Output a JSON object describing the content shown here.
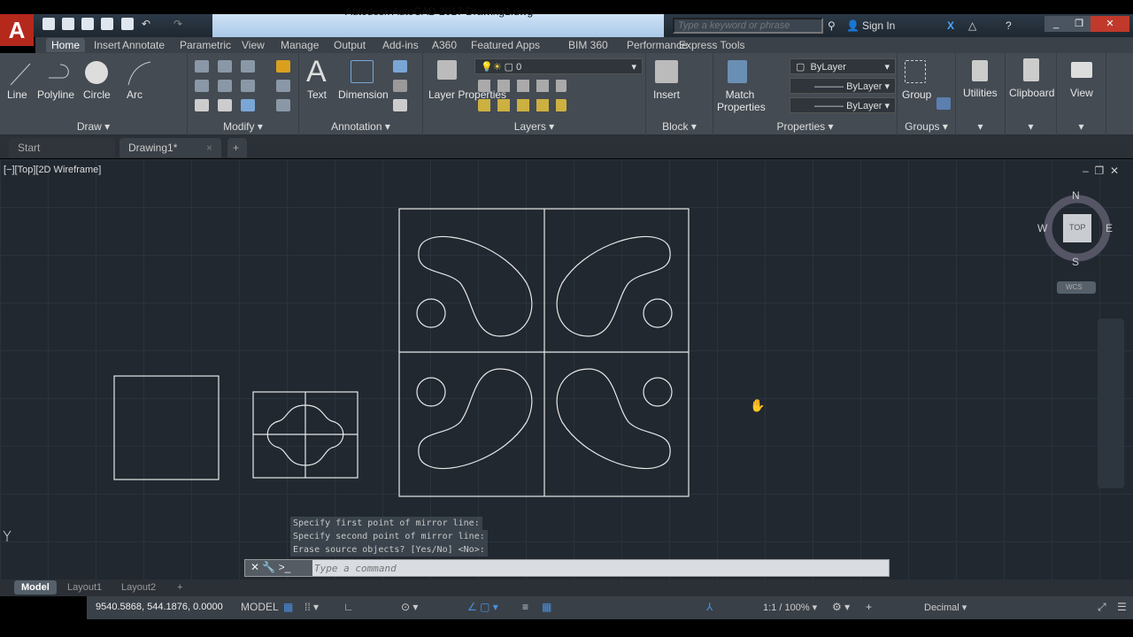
{
  "app": {
    "title": "Autodesk AutoCAD 2017    Drawing1.dwg",
    "logo": "A"
  },
  "search": {
    "placeholder": "Type a keyword or phrase"
  },
  "signin": "Sign In",
  "ribbon_tabs": [
    "Home",
    "Insert",
    "Annotate",
    "Parametric",
    "View",
    "Manage",
    "Output",
    "Add-ins",
    "A360",
    "Featured Apps",
    "BIM 360",
    "Performance",
    "Express Tools"
  ],
  "draw": {
    "title": "Draw",
    "line": "Line",
    "polyline": "Polyline",
    "circle": "Circle",
    "arc": "Arc"
  },
  "modify": {
    "title": "Modify"
  },
  "annotation": {
    "title": "Annotation",
    "text": "Text",
    "dimension": "Dimension"
  },
  "layers": {
    "title": "Layers",
    "layer_properties": "Layer Properties",
    "current_layer": "0"
  },
  "block": {
    "title": "Block",
    "insert": "Insert"
  },
  "properties": {
    "title": "Properties",
    "match": "Match Properties",
    "color": "ByLayer",
    "linetype": "ByLayer",
    "lineweight": "ByLayer"
  },
  "groups": {
    "title": "Groups",
    "group": "Group"
  },
  "utilities": "Utilities",
  "clipboard": "Clipboard",
  "view": "View",
  "file_tabs": [
    "Start",
    "Drawing1*"
  ],
  "viewport": {
    "label": "[−][Top][2D Wireframe]",
    "compass": {
      "n": "N",
      "s": "S",
      "e": "E",
      "w": "W",
      "top": "TOP",
      "wcs": "WCS"
    }
  },
  "command": {
    "history": [
      "Specify first point of mirror line:",
      "Specify second point of mirror line:",
      "Erase source objects? [Yes/No] <No>:"
    ],
    "placeholder": "Type a command"
  },
  "layout_tabs": [
    "Model",
    "Layout1",
    "Layout2"
  ],
  "status": {
    "coords": "9540.5868, 544.1876, 0.0000",
    "space": "MODEL",
    "scale": "1:1 / 100%",
    "units": "Decimal"
  }
}
